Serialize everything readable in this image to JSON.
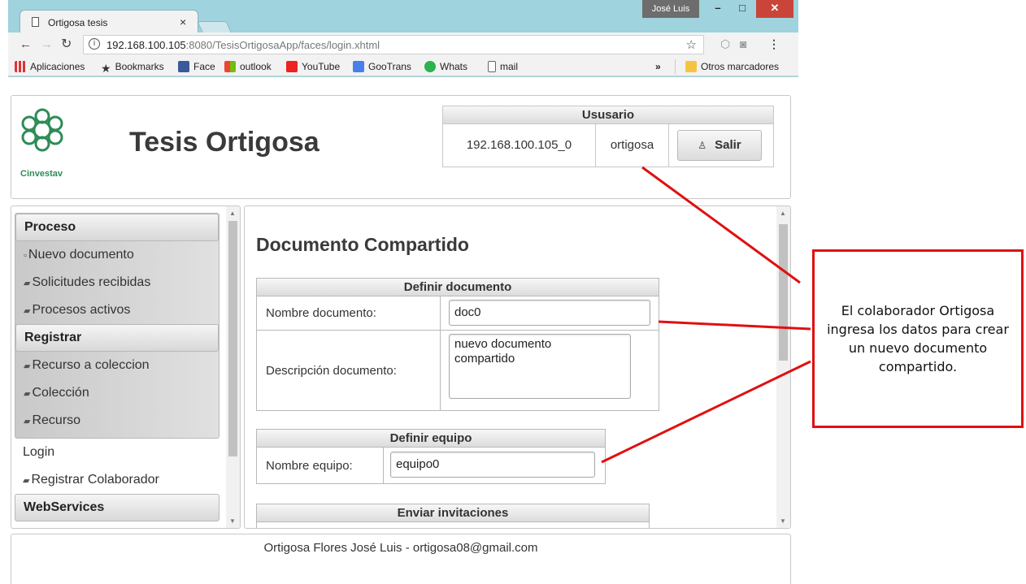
{
  "browser": {
    "tab_title": "Ortigosa tesis",
    "tab_close": "×",
    "os_user": "José Luis",
    "url_host": "192.168.100.105",
    "url_rest": ":8080/TesisOrtigosaApp/faces/login.xhtml",
    "bookmarks": [
      {
        "label": "Aplicaciones",
        "icon": "apps-icon"
      },
      {
        "label": "Bookmarks",
        "icon": "star-icon"
      },
      {
        "label": "Face",
        "icon": "facebook-icon"
      },
      {
        "label": "outlook",
        "icon": "outlook-icon"
      },
      {
        "label": "YouTube",
        "icon": "youtube-icon"
      },
      {
        "label": "GooTrans",
        "icon": "google-translate-icon"
      },
      {
        "label": "Whats",
        "icon": "whatsapp-icon"
      },
      {
        "label": "mail",
        "icon": "page-icon"
      }
    ],
    "bookmarks_more": "»",
    "other_bookmarks": "Otros marcadores"
  },
  "header": {
    "logo_text": "Cinvestav",
    "site_title": "Tesis Ortigosa"
  },
  "user_panel": {
    "title": "Ususario",
    "ip": "192.168.100.105_0",
    "username": "ortigosa",
    "logout_label": "Salir"
  },
  "sidebar": {
    "groups": [
      {
        "title": "Proceso",
        "items": [
          "Nuevo documento",
          "Solicitudes recibidas",
          "Procesos activos"
        ]
      },
      {
        "title": "Registrar",
        "items": [
          "Recurso a coleccion",
          "Colección",
          "Recurso"
        ]
      }
    ],
    "plain_items": [
      "Login",
      "Registrar Colaborador"
    ],
    "next_group": "WebServices"
  },
  "main": {
    "page_title": "Documento Compartido",
    "doc_section": {
      "title": "Definir documento",
      "name_label": "Nombre documento:",
      "name_value": "doc0",
      "desc_label": "Descripción documento:",
      "desc_value": "nuevo documento\ncompartido"
    },
    "team_section": {
      "title": "Definir equipo",
      "team_label": "Nombre equipo:",
      "team_value": "equipo0"
    },
    "invite_section": {
      "title": "Enviar invitaciones"
    }
  },
  "footer": {
    "text": "Ortigosa Flores José Luis - ortigosa08@gmail.com"
  },
  "annotation": {
    "text": "El colaborador Ortigosa ingresa los datos para crear un nuevo documento compartido."
  },
  "colors": {
    "annotation_red": "#e01010",
    "window_frame": "#9fd3dd",
    "logo_green": "#2e8b57"
  }
}
